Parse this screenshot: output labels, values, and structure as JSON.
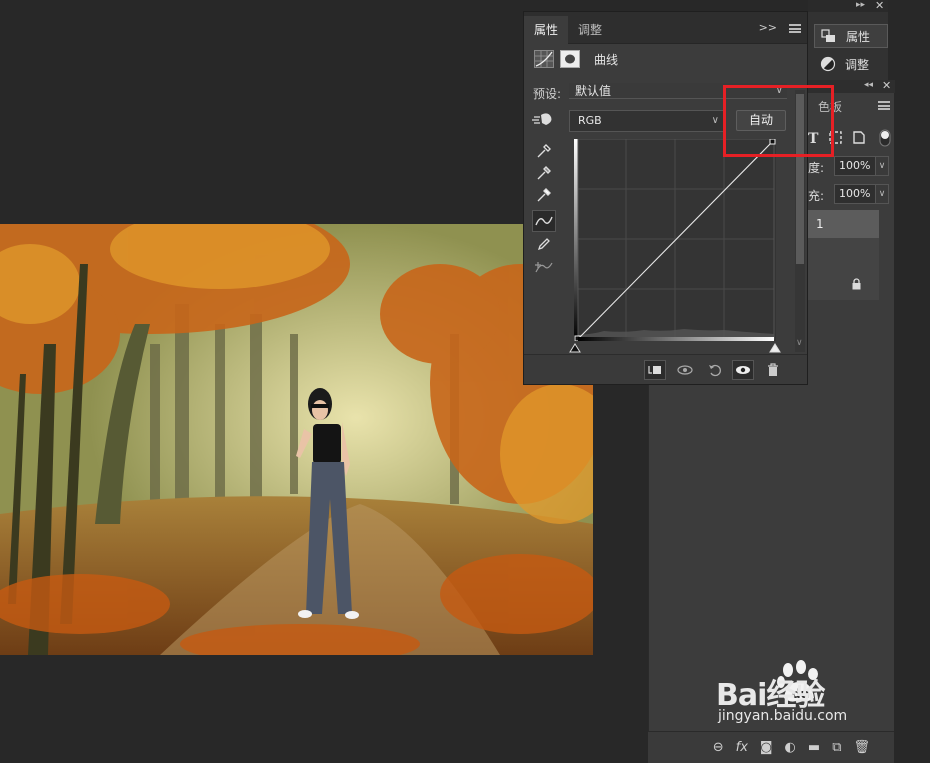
{
  "properties_panel": {
    "tabs": [
      {
        "label": "属性",
        "active": true
      },
      {
        "label": "调整",
        "active": false
      }
    ],
    "expand_icon": "double-chevron-right-icon",
    "title": "曲线",
    "preset_label": "预设:",
    "preset_value": "默认值",
    "channel_value": "RGB",
    "auto_button_label": "自动",
    "tools": [
      "on-image-adjust-icon",
      "black-point-eyedropper-icon",
      "gray-point-eyedropper-icon",
      "white-point-eyedropper-icon",
      "curve-point-icon",
      "pencil-icon",
      "smooth-icon"
    ],
    "footer_icons": [
      "clip-to-layer-icon",
      "view-previous-icon",
      "reset-icon",
      "visibility-eye-icon",
      "trash-icon"
    ]
  },
  "top_dock": {
    "items": [
      {
        "label": "属性",
        "icon": "properties-icon",
        "active": true
      },
      {
        "label": "调整",
        "icon": "adjustments-icon",
        "active": false
      }
    ]
  },
  "layers_panel": {
    "tab_label": "色板",
    "opacity_label": "度:",
    "opacity_value": "100%",
    "fill_label": "充:",
    "fill_value": "100%",
    "layer_name": "1",
    "bottom_icons": [
      "link-icon",
      "fx-icon",
      "mask-icon",
      "adjustment-layer-icon",
      "group-icon",
      "new-layer-icon",
      "trash-icon"
    ],
    "fx_label": "fx"
  },
  "watermark": {
    "brand": "Bai经验",
    "url": "jingyan.baidu.com"
  },
  "colors": {
    "highlight": "#e62025",
    "panel_bg": "#3c3c3c",
    "app_bg": "#282828"
  }
}
